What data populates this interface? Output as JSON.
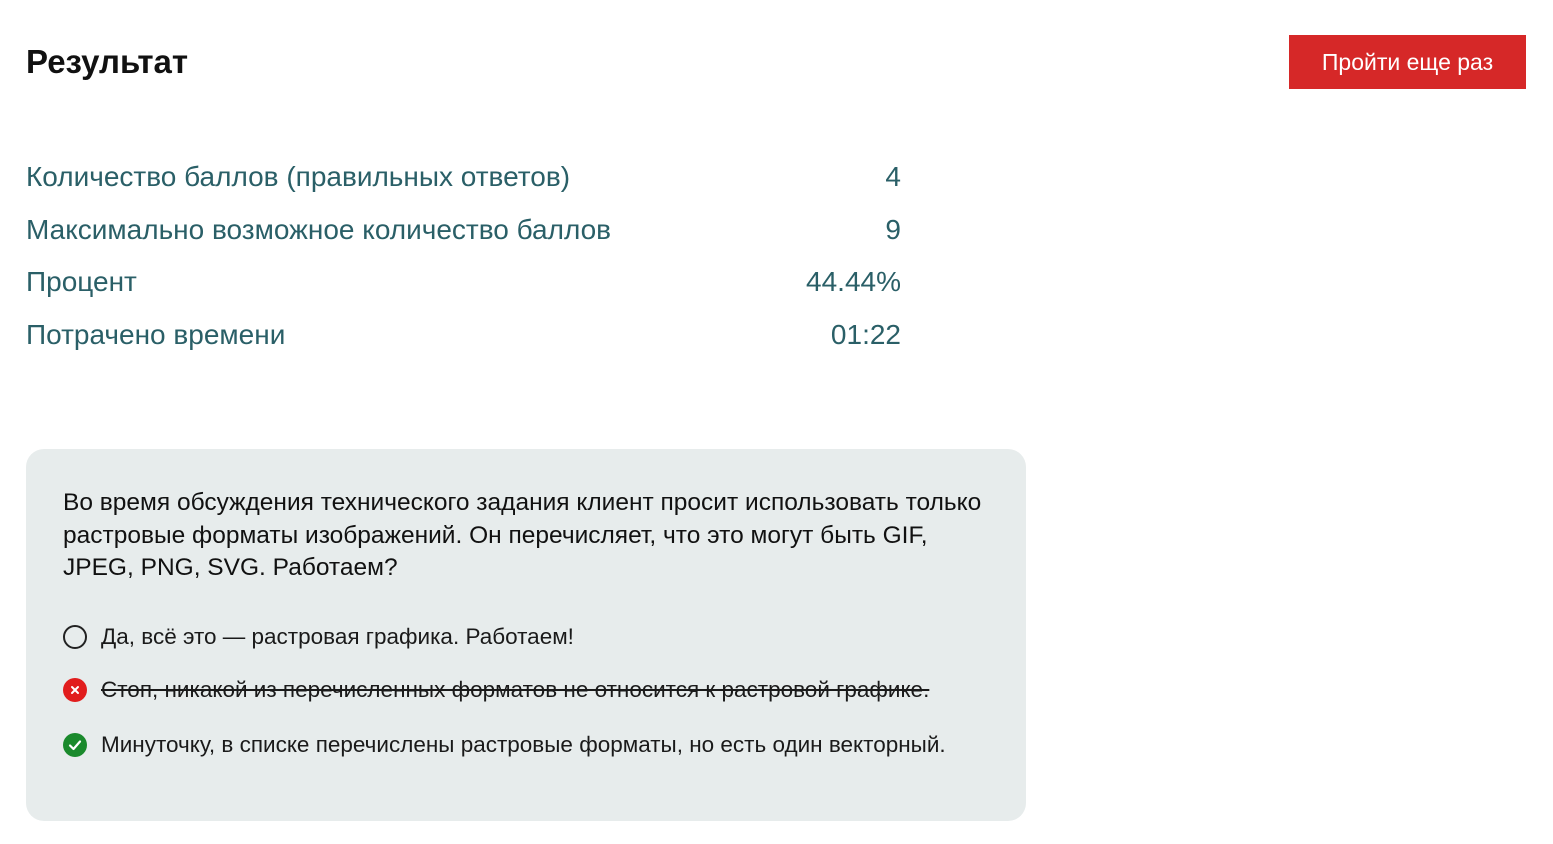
{
  "header": {
    "title": "Результат",
    "retry_label": "Пройти еще раз"
  },
  "stats": [
    {
      "label": "Количество баллов (правильных ответов)",
      "value": "4"
    },
    {
      "label": "Максимально возможное количество баллов",
      "value": "9"
    },
    {
      "label": "Процент",
      "value": "44.44%"
    },
    {
      "label": "Потрачено времени",
      "value": "01:22"
    }
  ],
  "question": {
    "text": "Во время обсуждения технического задания клиент просит использовать только растровые форматы изображений. Он перечисляет, что это могут быть GIF, JPEG, PNG, SVG. Работаем?",
    "answers": [
      {
        "label": "Да, всё это — растровая графика. Работаем!",
        "status": "unselected",
        "icon": "radio-empty-icon"
      },
      {
        "label": "Стоп, никакой из перечисленных форматов не относится к растровой графике.",
        "status": "wrong",
        "icon": "cross-circle-icon"
      },
      {
        "label": "Минуточку, в списке перечислены растровые форматы, но есть один векторный.",
        "status": "correct",
        "icon": "check-circle-icon"
      }
    ]
  },
  "colors": {
    "accent": "#d62828",
    "stat_text": "#2a5f67",
    "card_bg": "#e7ecec",
    "wrong": "#e11d1d",
    "correct": "#1a8a2c"
  }
}
